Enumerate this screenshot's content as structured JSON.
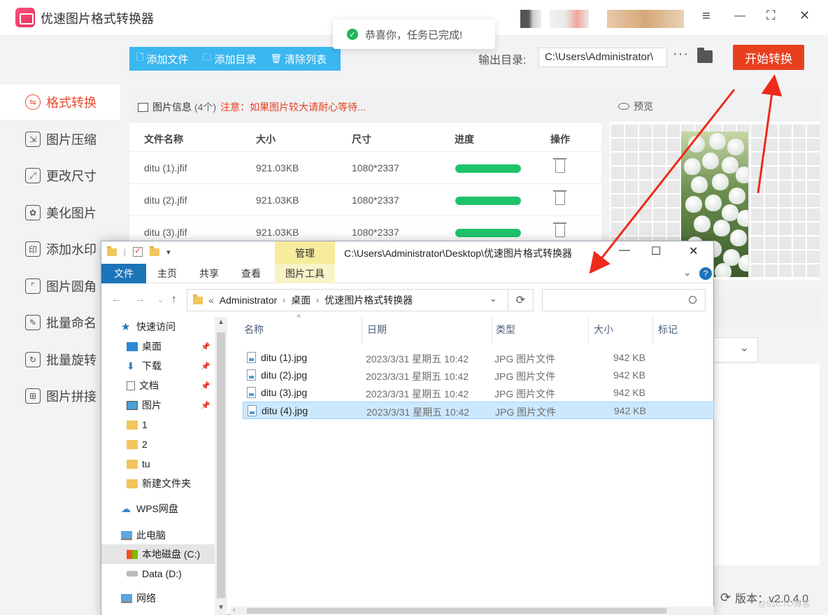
{
  "app": {
    "title": "优速图片格式转换器",
    "window_controls": {
      "menu": "≡",
      "minimize": "—",
      "maximize": "⛶",
      "close": "✕"
    }
  },
  "toast": {
    "message": "恭喜你，任务已完成!"
  },
  "sidebar": {
    "items": [
      {
        "label": "格式转换",
        "icon": "convert-icon",
        "active": true
      },
      {
        "label": "图片压缩",
        "icon": "compress-icon"
      },
      {
        "label": "更改尺寸",
        "icon": "resize-icon"
      },
      {
        "label": "美化图片",
        "icon": "beautify-icon"
      },
      {
        "label": "添加水印",
        "icon": "watermark-icon"
      },
      {
        "label": "图片圆角",
        "icon": "round-corner-icon"
      },
      {
        "label": "批量命名",
        "icon": "rename-icon"
      },
      {
        "label": "批量旋转",
        "icon": "rotate-icon"
      },
      {
        "label": "图片拼接",
        "icon": "stitch-icon"
      }
    ]
  },
  "toolbar": {
    "add_file": "添加文件",
    "add_dir": "添加目录",
    "clear_list": "清除列表"
  },
  "output": {
    "label": "输出目录:",
    "path": "C:\\Users\\Administrator\\",
    "more": "···",
    "start_button": "开始转换"
  },
  "image_panel": {
    "title": "图片信息",
    "count": "(4个)",
    "notice": "注意：如果图片较大请耐心等待...",
    "columns": [
      "文件名称",
      "大小",
      "尺寸",
      "进度",
      "操作"
    ],
    "rows": [
      {
        "name": "ditu (1).jfif",
        "size": "921.03KB",
        "dims": "1080*2337",
        "progress": 1.0
      },
      {
        "name": "ditu (2).jfif",
        "size": "921.03KB",
        "dims": "1080*2337",
        "progress": 1.0
      },
      {
        "name": "ditu (3).jfif",
        "size": "921.03KB",
        "dims": "1080*2337",
        "progress": 1.0
      }
    ]
  },
  "preview": {
    "title": "预览"
  },
  "footer": {
    "version": "版本：v2.0.4.0",
    "watermark": "@51CTO博客"
  },
  "explorer": {
    "manage_tab": "管理",
    "title_path": "C:\\Users\\Administrator\\Desktop\\优速图片格式转换器",
    "ribbon_tabs": [
      "文件",
      "主页",
      "共享",
      "查看",
      "图片工具"
    ],
    "help": "?",
    "address": {
      "prefix": "«",
      "crumbs": [
        "Administrator",
        "桌面",
        "优速图片格式转换器"
      ]
    },
    "nav": [
      {
        "label": "快速访问",
        "icon": "star-icon",
        "kind": "star"
      },
      {
        "label": "桌面",
        "icon": "desktop-icon",
        "kind": "desk",
        "pinned": true
      },
      {
        "label": "下载",
        "icon": "download-icon",
        "kind": "down",
        "pinned": true
      },
      {
        "label": "文档",
        "icon": "document-icon",
        "kind": "doc",
        "pinned": true
      },
      {
        "label": "图片",
        "icon": "pictures-icon",
        "kind": "pic",
        "pinned": true
      },
      {
        "label": "1",
        "icon": "folder-icon",
        "kind": "folder"
      },
      {
        "label": "2",
        "icon": "folder-icon",
        "kind": "folder"
      },
      {
        "label": "tu",
        "icon": "folder-icon",
        "kind": "folder"
      },
      {
        "label": "新建文件夹",
        "icon": "folder-icon",
        "kind": "folder"
      },
      {
        "label": "WPS网盘",
        "icon": "cloud-icon",
        "kind": "cloud"
      },
      {
        "label": "此电脑",
        "icon": "computer-icon",
        "kind": "pc"
      },
      {
        "label": "本地磁盘 (C:)",
        "icon": "windows-drive-icon",
        "kind": "win",
        "selected": true
      },
      {
        "label": "Data (D:)",
        "icon": "drive-icon",
        "kind": "drive"
      },
      {
        "label": "网络",
        "icon": "network-icon",
        "kind": "pc"
      }
    ],
    "columns": [
      "名称",
      "日期",
      "类型",
      "大小",
      "标记"
    ],
    "files": [
      {
        "name": "ditu (1).jpg",
        "date": "2023/3/31 星期五 10:42",
        "type": "JPG 图片文件",
        "size": "942 KB"
      },
      {
        "name": "ditu (2).jpg",
        "date": "2023/3/31 星期五 10:42",
        "type": "JPG 图片文件",
        "size": "942 KB"
      },
      {
        "name": "ditu (3).jpg",
        "date": "2023/3/31 星期五 10:42",
        "type": "JPG 图片文件",
        "size": "942 KB"
      },
      {
        "name": "ditu (4).jpg",
        "date": "2023/3/31 星期五 10:42",
        "type": "JPG 图片文件",
        "size": "942 KB",
        "selected": true
      }
    ]
  },
  "colors": {
    "accent_red": "#e8401f",
    "toolbar_blue": "#3bb7f0",
    "progress_green": "#1fc36b",
    "explorer_blue": "#1c74b8",
    "annotation_arrow": "#ee2a1a"
  }
}
